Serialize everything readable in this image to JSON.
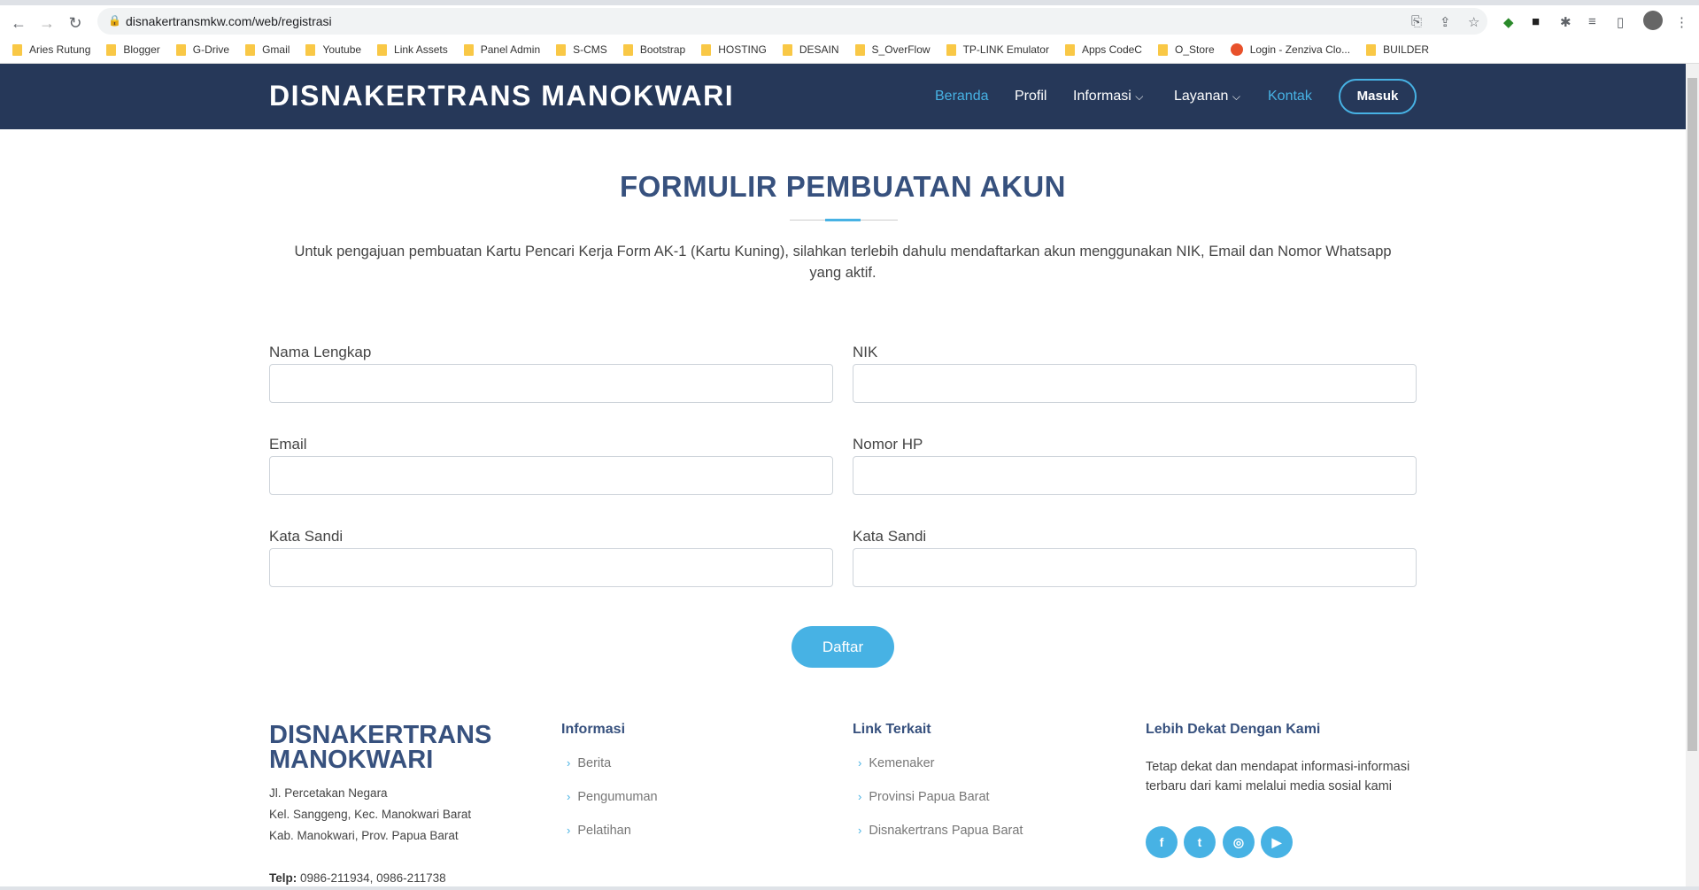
{
  "browser": {
    "url": "disnakertransmkw.com/web/registrasi",
    "bookmarks": [
      "Aries Rutung",
      "Blogger",
      "G-Drive",
      "Gmail",
      "Youtube",
      "Link Assets",
      "Panel Admin",
      "S-CMS",
      "Bootstrap",
      "HOSTING",
      "DESAIN",
      "S_OverFlow",
      "TP-LINK Emulator",
      "Apps CodeC",
      "O_Store",
      "Login - Zenziva Clo...",
      "BUILDER"
    ]
  },
  "header": {
    "brand": "DISNAKERTRANS MANOKWARI",
    "nav": [
      "Beranda",
      "Profil",
      "Informasi",
      "Layanan",
      "Kontak"
    ],
    "login": "Masuk"
  },
  "form": {
    "title": "FORMULIR PEMBUATAN AKUN",
    "description": "Untuk pengajuan pembuatan Kartu Pencari Kerja Form AK-1 (Kartu Kuning), silahkan terlebih dahulu mendaftarkan akun menggunakan NIK, Email dan Nomor Whatsapp yang aktif.",
    "fields": [
      {
        "label": "Nama Lengkap",
        "value": ""
      },
      {
        "label": "NIK",
        "value": ""
      },
      {
        "label": "Email",
        "value": ""
      },
      {
        "label": "Nomor HP",
        "value": ""
      },
      {
        "label": "Kata Sandi",
        "value": ""
      },
      {
        "label": "Kata Sandi",
        "value": ""
      }
    ],
    "submit": "Daftar"
  },
  "footer": {
    "brand_line1": "DISNAKERTRANS",
    "brand_line2": "MANOKWARI",
    "address": [
      "Jl. Percetakan Negara",
      "Kel. Sanggeng, Kec. Manokwari Barat",
      "Kab. Manokwari, Prov. Papua Barat"
    ],
    "telp_label": "Telp:",
    "telp": "0986-211934, 0986-211738",
    "col1": {
      "title": "Informasi",
      "links": [
        "Berita",
        "Pengumuman",
        "Pelatihan"
      ]
    },
    "col2": {
      "title": "Link Terkait",
      "links": [
        "Kemenaker",
        "Provinsi Papua Barat",
        "Disnakertrans Papua Barat"
      ]
    },
    "col3": {
      "title": "Lebih Dekat Dengan Kami",
      "text": "Tetap dekat dan mendapat informasi-informasi terbaru dari kami melalui media sosial kami",
      "social": [
        "facebook-icon",
        "twitter-icon",
        "instagram-icon",
        "youtube-icon"
      ]
    }
  },
  "colors": {
    "navbar": "#263859",
    "accent": "#47b2e4",
    "heading": "#37517e"
  }
}
